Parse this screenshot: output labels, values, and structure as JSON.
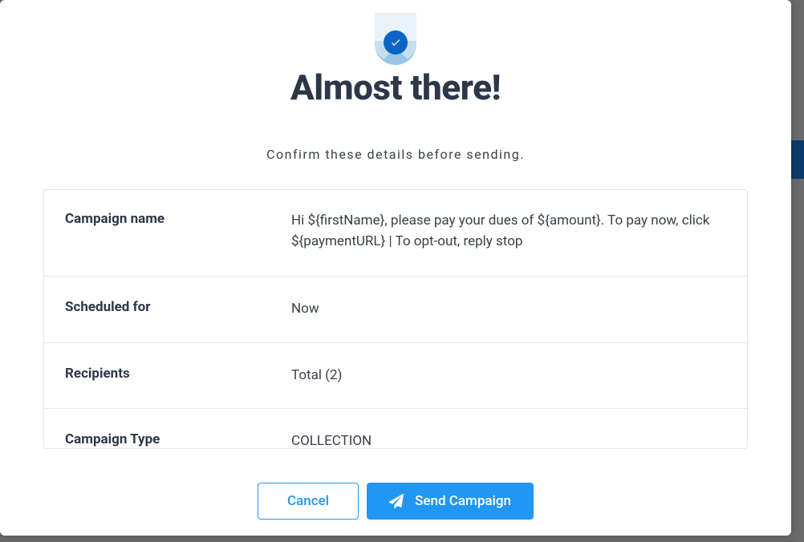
{
  "modal": {
    "title": "Almost there!",
    "subtitle": "Confirm these details before sending."
  },
  "details": {
    "campaign_name": {
      "label": "Campaign name",
      "value": "Hi ${firstName}, please pay your dues of ${amount}. To pay now, click ${paymentURL} | To opt-out, reply stop"
    },
    "scheduled_for": {
      "label": "Scheduled for",
      "value": "Now"
    },
    "recipients": {
      "label": "Recipients",
      "value": "Total (2)"
    },
    "campaign_type": {
      "label": "Campaign Type",
      "value": "COLLECTION"
    }
  },
  "actions": {
    "cancel_label": "Cancel",
    "send_label": "Send Campaign"
  }
}
